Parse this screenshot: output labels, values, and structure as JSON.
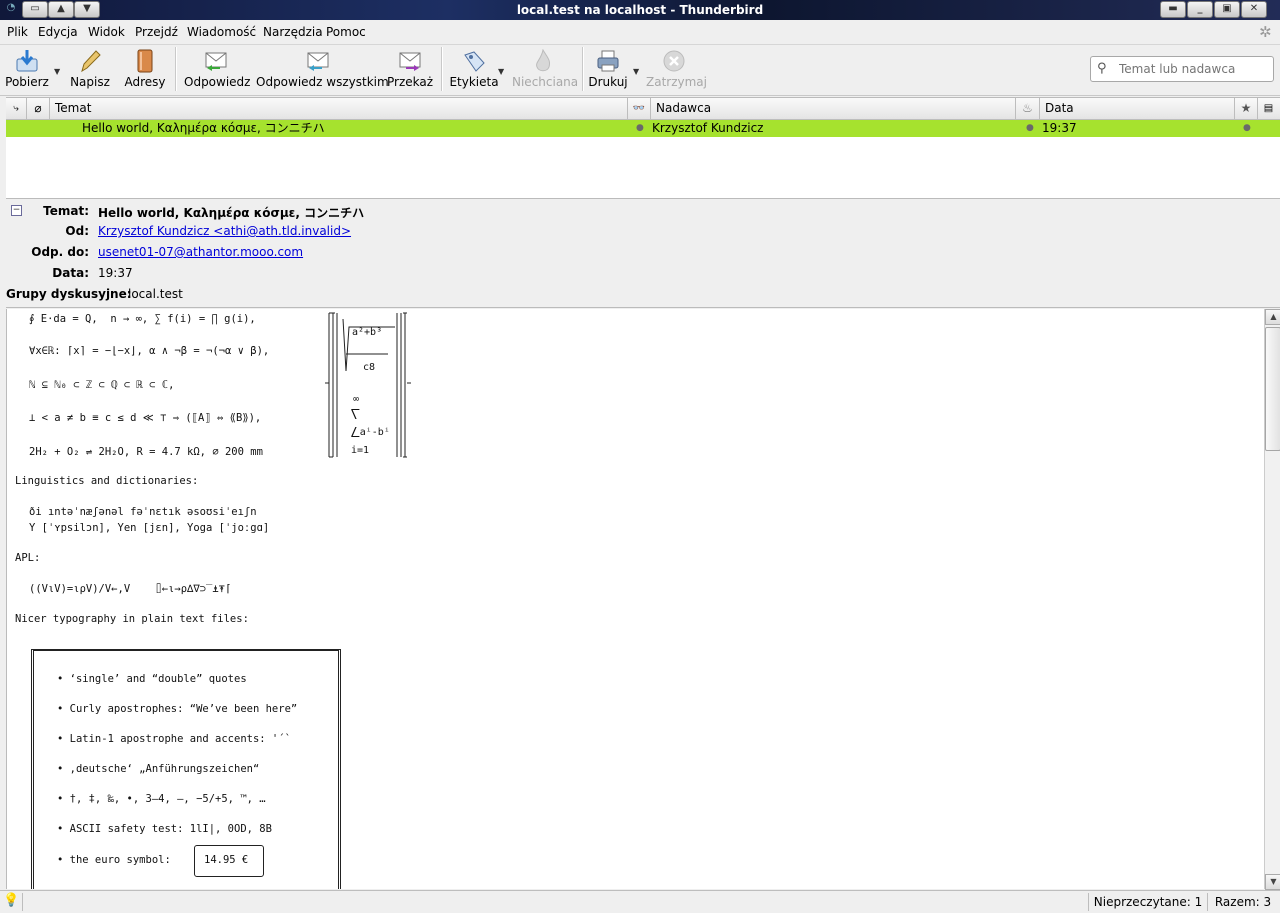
{
  "window": {
    "title": "local.test na localhost - Thunderbird"
  },
  "menu": [
    "Plik",
    "Edycja",
    "Widok",
    "Przejdź",
    "Wiadomość",
    "Narzędzia",
    "Pomoc"
  ],
  "toolbar": {
    "get": "Pobierz",
    "write": "Napisz",
    "address": "Adresy",
    "reply": "Odpowiedz",
    "reply_all": "Odpowiedz wszystkim",
    "forward": "Przekaż",
    "tag": "Etykieta",
    "junk": "Niechciana",
    "print": "Drukuj",
    "stop": "Zatrzymaj",
    "search_placeholder": "Temat lub nadawca"
  },
  "columns": {
    "subject": "Temat",
    "sender": "Nadawca",
    "date": "Data"
  },
  "messages": [
    {
      "subject": "Hello world, Καλημέρα κόσμε, コンニチハ",
      "sender": "Krzysztof Kundzicz",
      "date": "19:37",
      "selected": true,
      "color": "#a6e22e"
    }
  ],
  "header": {
    "subject_label": "Temat:",
    "subject": "Hello world, Καλημέρα κόσμε, コンニチハ",
    "from_label": "Od:",
    "from": "Krzysztof Kundzicz <athi@ath.tld.invalid>",
    "replyto_label": "Odp. do:",
    "replyto": "usenet01-07@athantor.mooo.com",
    "date_label": "Data:",
    "date": "19:37",
    "groups_label": "Grupy dyskusyjne:",
    "groups": "local.test"
  },
  "body": {
    "math1": "∮ E⋅da = Q,  n → ∞, ∑ f(i) = ∏ g(i),",
    "math2": "∀x∈ℝ: ⌈x⌉ = −⌊−x⌋, α ∧ ¬β = ¬(¬α ∨ β),",
    "math3": "ℕ ⊆ ℕ₀ ⊂ ℤ ⊂ ℚ ⊂ ℝ ⊂ ℂ,",
    "math4": "⊥ < a ≠ b ≡ c ≤ d ≪ ⊤ ⇒ (⟦A⟧ ⇔ ⟪B⟫),",
    "math5": "2H₂ + O₂ ⇌ 2H₂O, R = 4.7 kΩ, ⌀ 200 mm",
    "formula_num": "a²+b³",
    "formula_den": "c8",
    "formula_inf": "∞",
    "formula_sum": "⎲",
    "formula_term": "⎳aⁱ-bⁱ",
    "formula_index": "i=1",
    "ling_title": "Linguistics and dictionaries:",
    "ipa1": "ði ıntəˈnæʃənəl fəˈnɛtık əsoʊsiˈeıʃn",
    "ipa2": "Y [ˈʏpsilɔn], Yen [jɛn], Yoga [ˈjoːgɑ]",
    "apl_title": "APL:",
    "apl": "((V⍳V)=⍳⍴V)/V←,V    ⌷←⍳→⍴∆∇⊃‾⍎⍕⌈",
    "typo_title": "Nicer typography in plain text files:",
    "bullets": [
      "• ‘single’ and “double” quotes",
      "• Curly apostrophes: “We’ve been here”",
      "• Latin-1 apostrophe and accents: '´`",
      "• ‚deutsche‘ „Anführungszeichen“",
      "• †, ‡, ‰, •, 3–4, —, −5/+5, ™, …",
      "• ASCII safety test: 1lI|, 0OD, 8B",
      "• the euro symbol:"
    ],
    "euro": "14.95 €"
  },
  "status": {
    "unread": "Nieprzeczytane: 1",
    "total": "Razem: 3"
  }
}
